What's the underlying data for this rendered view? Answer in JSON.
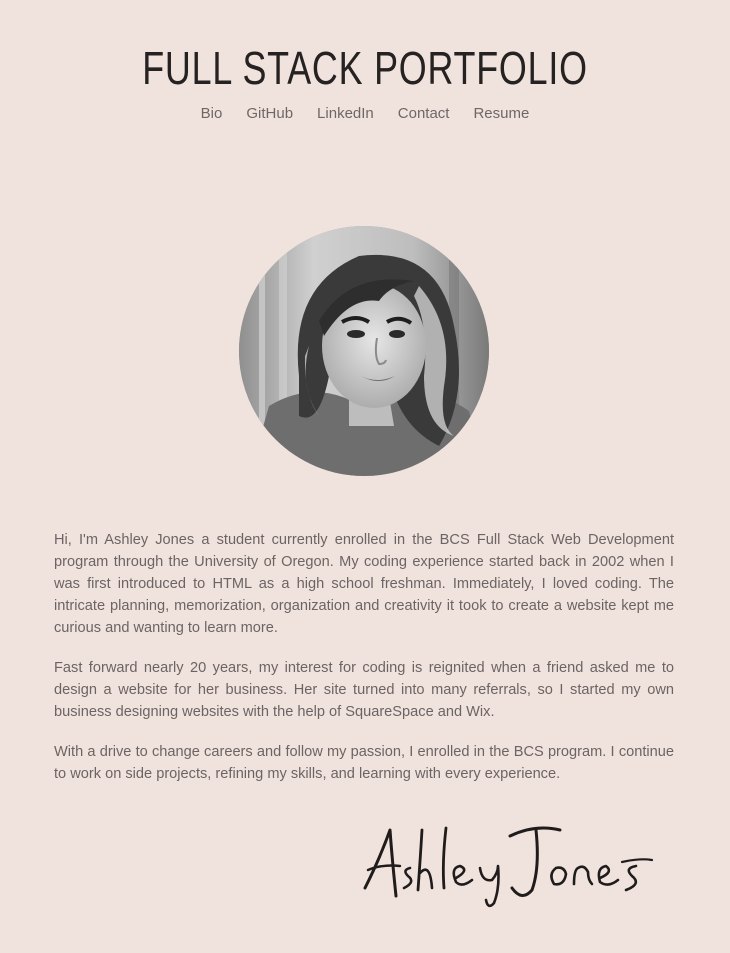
{
  "header": {
    "title": "FULL STACK PORTFOLIO"
  },
  "nav": {
    "items": [
      {
        "label": "Bio"
      },
      {
        "label": "GitHub"
      },
      {
        "label": "LinkedIn"
      },
      {
        "label": "Contact"
      },
      {
        "label": "Resume"
      }
    ]
  },
  "bio": {
    "paragraphs": [
      "Hi, I'm Ashley Jones a student currently enrolled in the BCS Full Stack Web Development program through the University of Oregon. My coding experience started back in 2002 when I was first introduced to HTML as a high school freshman. Immediately, I loved coding. The intricate planning, memorization, organization and creativity it took to create a website kept me curious and wanting to learn more.",
      "Fast forward nearly 20 years, my interest for coding is reignited when a friend asked me to design a website for her business. Her site turned into many referrals, so I started my own business designing websites with the help of SquareSpace and Wix.",
      "With a drive to change careers and follow my passion, I enrolled in the BCS program. I continue to work on side projects, refining my skills, and learning with every experience."
    ]
  },
  "signature": {
    "text": "Ashley Jones"
  },
  "colors": {
    "background": "#f0e3de",
    "title": "#252221",
    "text": "#6c6463"
  }
}
